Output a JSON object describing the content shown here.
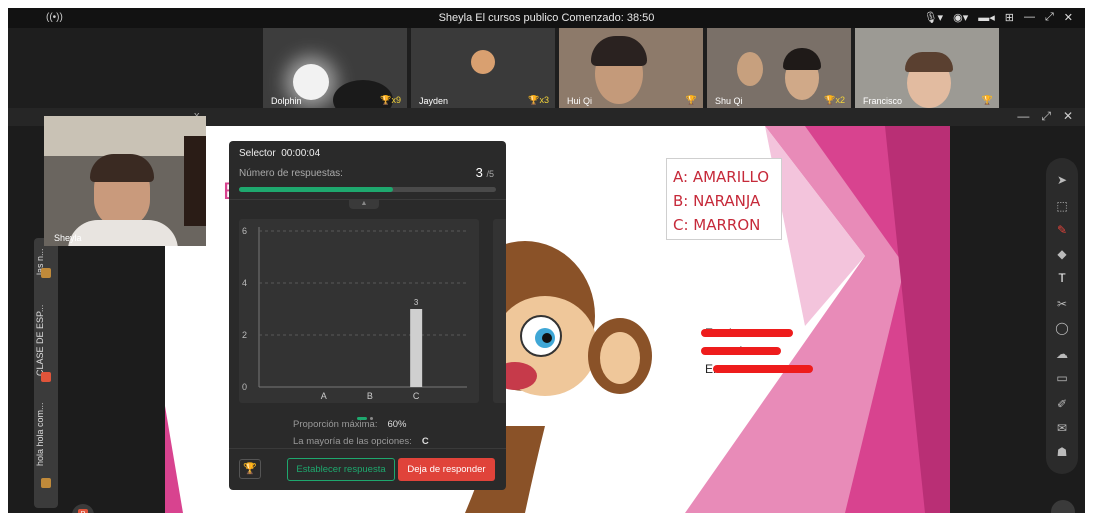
{
  "window": {
    "title": "Sheyla El cursos publico  Comenzado: 38:50"
  },
  "participants": [
    {
      "name": "Dolphin",
      "badge": "x9"
    },
    {
      "name": "Jayden",
      "badge": "x3"
    },
    {
      "name": "Hui Qi",
      "badge": ""
    },
    {
      "name": "Shu Qi",
      "badge": "x2"
    },
    {
      "name": "Francisco",
      "badge": ""
    }
  ],
  "presenter": {
    "name": "Sheyla"
  },
  "rail": {
    "items": [
      {
        "label": "las n..."
      },
      {
        "label": "CLASE DE ESP..."
      },
      {
        "label": "hola hola com..."
      }
    ]
  },
  "slide": {
    "letter": "E",
    "answers": [
      "A: AMARILLO",
      "B: NARANJA",
      "C: MARRON"
    ],
    "partial_text": [
      "Es el mono.",
      "..........ía.",
      "E..........."
    ]
  },
  "selector": {
    "title": "Selector",
    "timer": "00:00:04",
    "responses_label": "Número de respuestas:",
    "responses_count": "3",
    "responses_total": "/5",
    "progress": 0.6,
    "chart_data": {
      "type": "bar",
      "categories": [
        "A",
        "B",
        "C"
      ],
      "values": [
        0,
        0,
        3
      ],
      "value_labels": [
        "",
        "",
        "3"
      ],
      "y_ticks": [
        "0",
        "2",
        "4",
        "6"
      ],
      "ylim": [
        0,
        6
      ]
    },
    "max_ratio_label": "Proporción máxima:",
    "max_ratio_value": "60%",
    "majority_label": "La mayoría de las opciones:",
    "majority_value": "C",
    "set_answer_button": "Establecer respuesta",
    "stop_button": "Deja de responder"
  },
  "colors": {
    "accent": "#1ea86e",
    "danger": "#e0433a",
    "slide_pink": "#d8438f",
    "answers_red": "#c62a3a"
  }
}
